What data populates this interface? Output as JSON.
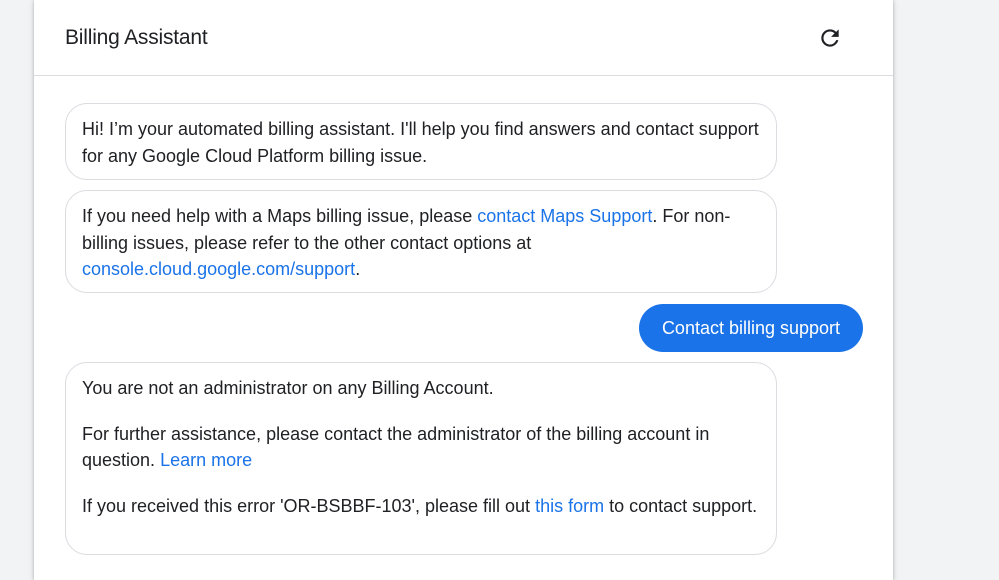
{
  "header": {
    "title": "Billing Assistant",
    "refresh_icon": "refresh-icon"
  },
  "messages": {
    "greeting": {
      "text": "Hi! I’m your automated billing assistant. I'll help you find answers and contact support for any Google Cloud Platform billing issue."
    },
    "maps": {
      "prefix": "If you need help with a Maps billing issue, please ",
      "link1": "contact Maps Support",
      "middle": ". For non-billing issues, please refer to the other contact options at ",
      "link2": "console.cloud.google.com/support",
      "suffix": "."
    },
    "user_reply": "Contact billing support",
    "admin": {
      "line1": "You are not an administrator on any Billing Account.",
      "line2_prefix": "For further assistance, please contact the administrator of the billing account in question. ",
      "learn_more": "Learn more",
      "line3_prefix": "If you received this error 'OR-BSBBF-103', please fill out ",
      "form_link": "this form",
      "line3_suffix": " to contact support."
    }
  },
  "colors": {
    "accent": "#1a73e8",
    "text": "#202124",
    "border": "#dadce0"
  }
}
